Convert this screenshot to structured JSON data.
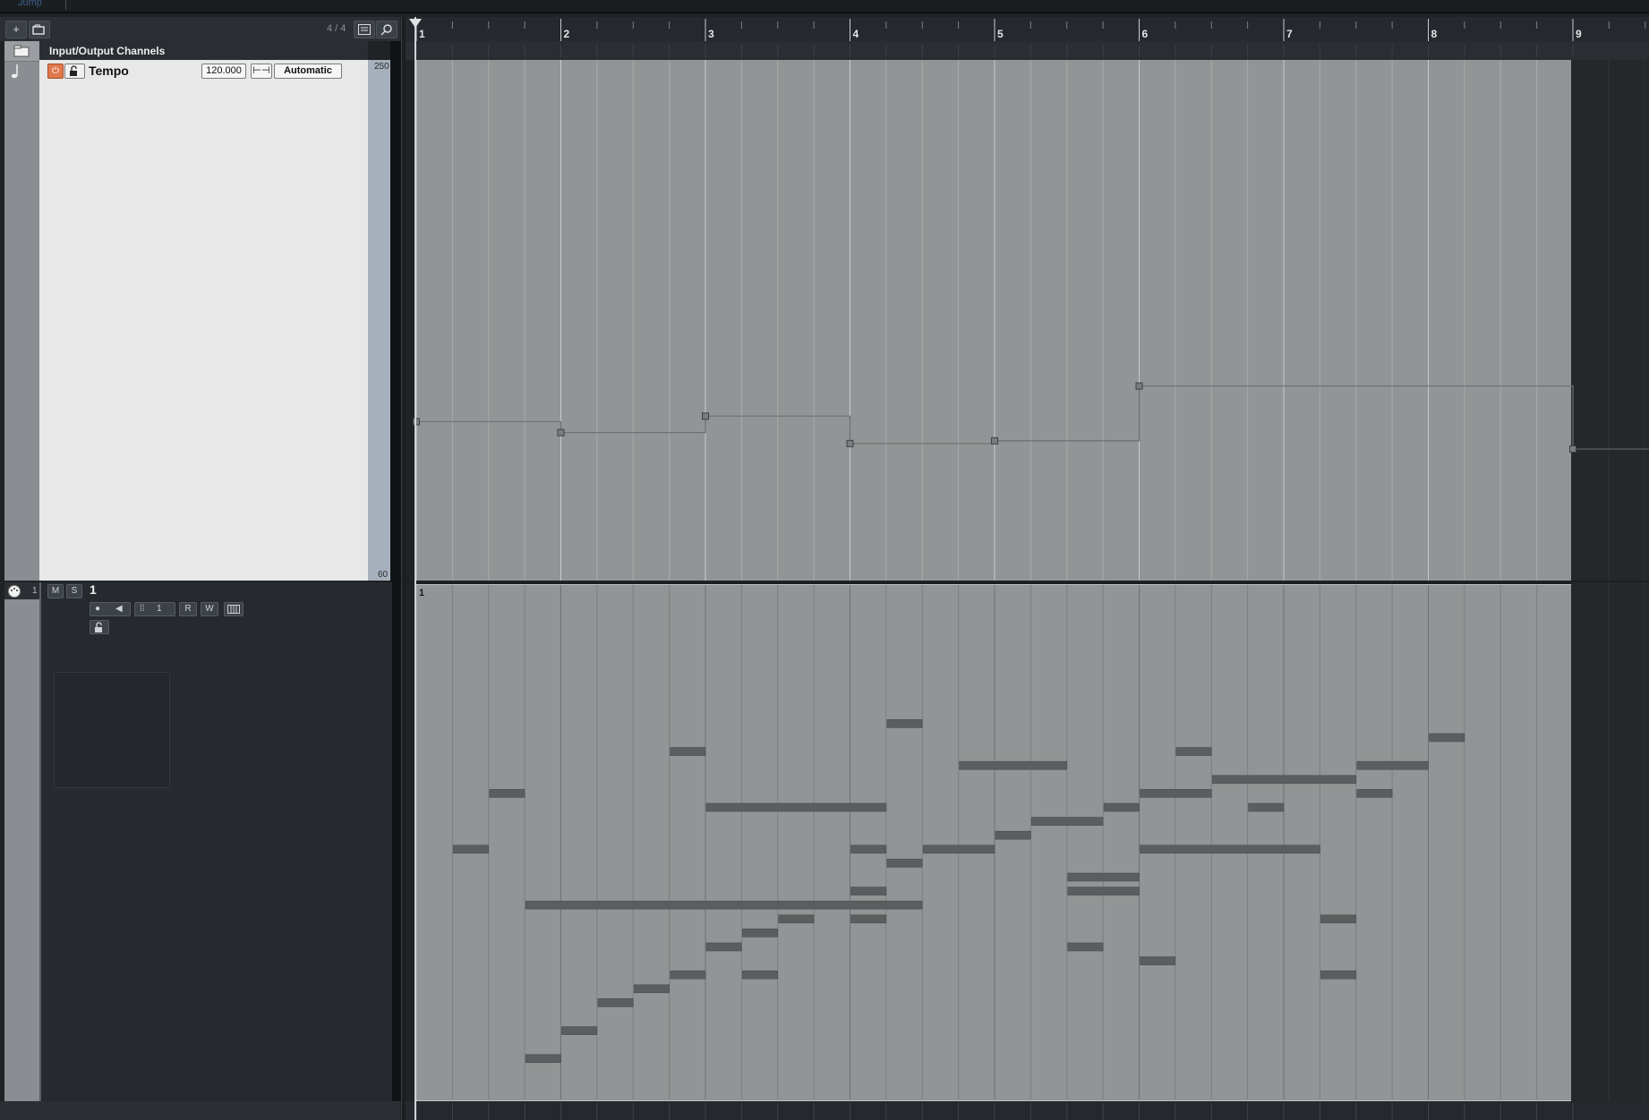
{
  "topbar": {
    "label": "Jump"
  },
  "toolbar": {
    "add_track_label": "+",
    "signature": "4 / 4"
  },
  "folder": {
    "title": "Input/Output Channels"
  },
  "tempo_track": {
    "name": "Tempo",
    "tempo_value": "120.000",
    "mode_label": "Automatic",
    "scale_max": "250",
    "scale_min": "60",
    "power_glyph": "⏻",
    "lock_glyph": "🔓",
    "fit_glyph": "⊢⊣"
  },
  "midi_track": {
    "number": "1",
    "name": "1",
    "mute_label": "M",
    "solo_label": "S",
    "read_label": "R",
    "write_label": "W",
    "channel_label": "1",
    "part_name": "1"
  },
  "ruler": {
    "bars": [
      "1",
      "2",
      "3",
      "4",
      "5",
      "6",
      "7",
      "8",
      "9"
    ]
  },
  "tempo_points": [
    {
      "bar": 1.0,
      "bpm": 118.0
    },
    {
      "bar": 2.0,
      "bpm": 114.0
    },
    {
      "bar": 3.0,
      "bpm": 120.0
    },
    {
      "bar": 4.0,
      "bpm": 110.0
    },
    {
      "bar": 5.0,
      "bpm": 111.0
    },
    {
      "bar": 6.0,
      "bpm": 131.0
    },
    {
      "bar": 9.0,
      "bpm": 108.0
    }
  ],
  "midi_notes": [
    {
      "start": 1.25,
      "len": 0.25,
      "pitch": 17
    },
    {
      "start": 1.5,
      "len": 0.25,
      "pitch": 21
    },
    {
      "start": 1.75,
      "len": 0.25,
      "pitch": 2
    },
    {
      "start": 1.75,
      "len": 2.75,
      "pitch": 13
    },
    {
      "start": 2.0,
      "len": 0.25,
      "pitch": 4
    },
    {
      "start": 2.25,
      "len": 0.25,
      "pitch": 6
    },
    {
      "start": 2.5,
      "len": 0.25,
      "pitch": 7
    },
    {
      "start": 2.75,
      "len": 0.25,
      "pitch": 8
    },
    {
      "start": 2.75,
      "len": 0.25,
      "pitch": 24
    },
    {
      "start": 3.0,
      "len": 0.25,
      "pitch": 10
    },
    {
      "start": 3.0,
      "len": 1.25,
      "pitch": 20
    },
    {
      "start": 3.25,
      "len": 0.25,
      "pitch": 8
    },
    {
      "start": 3.25,
      "len": 0.25,
      "pitch": 11
    },
    {
      "start": 3.5,
      "len": 0.25,
      "pitch": 12
    },
    {
      "start": 4.0,
      "len": 0.25,
      "pitch": 12
    },
    {
      "start": 4.0,
      "len": 0.25,
      "pitch": 14
    },
    {
      "start": 4.0,
      "len": 0.25,
      "pitch": 17
    },
    {
      "start": 4.25,
      "len": 0.25,
      "pitch": 16
    },
    {
      "start": 4.25,
      "len": 0.25,
      "pitch": 26
    },
    {
      "start": 4.5,
      "len": 0.5,
      "pitch": 17
    },
    {
      "start": 4.75,
      "len": 0.75,
      "pitch": 23
    },
    {
      "start": 5.0,
      "len": 0.25,
      "pitch": 18
    },
    {
      "start": 5.25,
      "len": 0.5,
      "pitch": 19
    },
    {
      "start": 5.5,
      "len": 0.25,
      "pitch": 10
    },
    {
      "start": 5.5,
      "len": 0.5,
      "pitch": 14
    },
    {
      "start": 5.5,
      "len": 0.5,
      "pitch": 15
    },
    {
      "start": 5.75,
      "len": 0.25,
      "pitch": 20
    },
    {
      "start": 6.0,
      "len": 0.25,
      "pitch": 9
    },
    {
      "start": 6.0,
      "len": 0.5,
      "pitch": 21
    },
    {
      "start": 6.0,
      "len": 1.25,
      "pitch": 17
    },
    {
      "start": 6.25,
      "len": 0.25,
      "pitch": 24
    },
    {
      "start": 6.5,
      "len": 1.0,
      "pitch": 22
    },
    {
      "start": 6.75,
      "len": 0.25,
      "pitch": 20
    },
    {
      "start": 7.25,
      "len": 0.25,
      "pitch": 8
    },
    {
      "start": 7.25,
      "len": 0.25,
      "pitch": 12
    },
    {
      "start": 7.5,
      "len": 0.25,
      "pitch": 21
    },
    {
      "start": 7.5,
      "len": 0.5,
      "pitch": 23
    },
    {
      "start": 8.0,
      "len": 0.25,
      "pitch": 25
    }
  ]
}
